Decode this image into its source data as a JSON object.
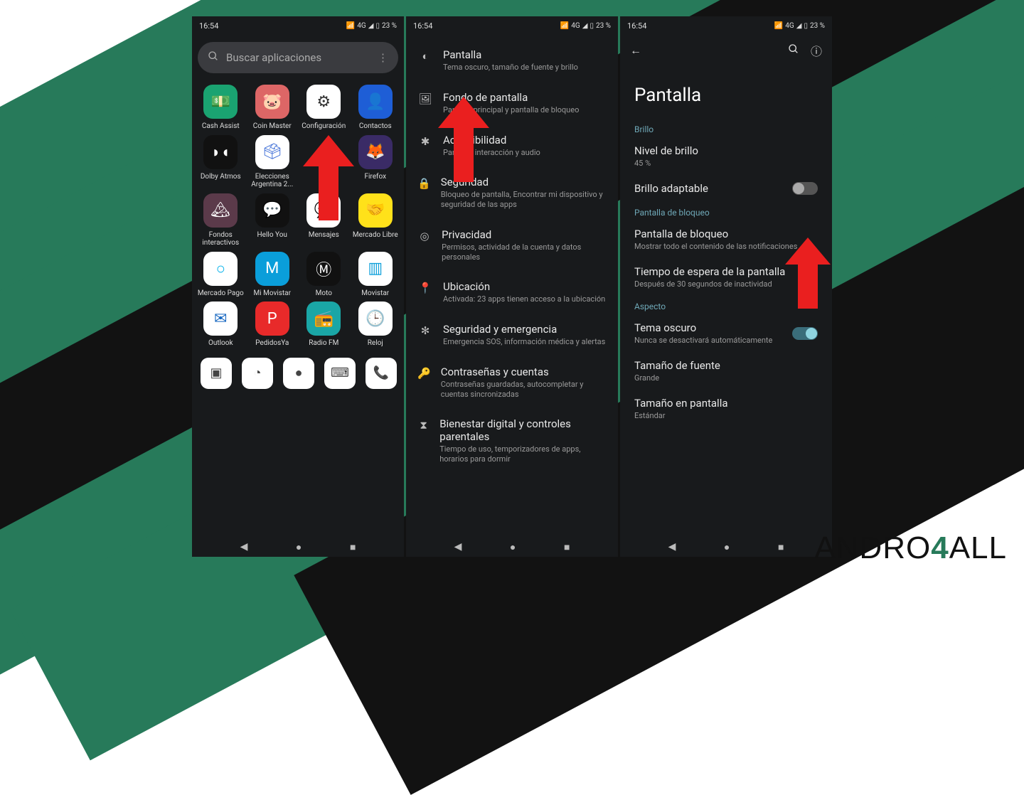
{
  "status": {
    "time": "16:54",
    "battery": "23 %",
    "signal_text": "4G"
  },
  "phone1": {
    "search_placeholder": "Buscar aplicaciones",
    "apps": [
      {
        "label": "Cash Assist",
        "emoji": "💵",
        "bg": "#1aa371",
        "fg": "#fff"
      },
      {
        "label": "Coin Master",
        "emoji": "🐷",
        "bg": "#d66",
        "fg": "#fff"
      },
      {
        "label": "Configuración",
        "emoji": "⚙",
        "bg": "#fff",
        "fg": "#333"
      },
      {
        "label": "Contactos",
        "emoji": "👤",
        "bg": "#1e5ed6",
        "fg": "#fff"
      },
      {
        "label": "Dolby Atmos",
        "emoji": "◗◖",
        "bg": "#111",
        "fg": "#fff"
      },
      {
        "label": "Elecciones Argentina 2...",
        "emoji": "🗳",
        "bg": "#fff",
        "fg": "#3a6bd6"
      },
      {
        "label": "",
        "emoji": "",
        "bg": "transparent",
        "fg": "transparent"
      },
      {
        "label": "Firefox",
        "emoji": "🦊",
        "bg": "#3a2b66",
        "fg": "#fff"
      },
      {
        "label": "Fondos interactivos",
        "emoji": "🏔",
        "bg": "#5b3a4a",
        "fg": "#fff"
      },
      {
        "label": "Hello You",
        "emoji": "💬",
        "bg": "#111",
        "fg": "#fff"
      },
      {
        "label": "Mensajes",
        "emoji": "💬",
        "bg": "#fff",
        "fg": "#2d6bff"
      },
      {
        "label": "Mercado Libre",
        "emoji": "🤝",
        "bg": "#ffe11a",
        "fg": "#333"
      },
      {
        "label": "Mercado Pago",
        "emoji": "○",
        "bg": "#fff",
        "fg": "#00b1ea"
      },
      {
        "label": "Mi Movistar",
        "emoji": "M",
        "bg": "#0a9eda",
        "fg": "#fff"
      },
      {
        "label": "Moto",
        "emoji": "Ⓜ",
        "bg": "#111",
        "fg": "#fff"
      },
      {
        "label": "Movistar",
        "emoji": "▥",
        "bg": "#fff",
        "fg": "#0a9eda"
      },
      {
        "label": "Outlook",
        "emoji": "✉",
        "bg": "#fff",
        "fg": "#1566c0"
      },
      {
        "label": "PedidosYa",
        "emoji": "P",
        "bg": "#e82a2a",
        "fg": "#fff"
      },
      {
        "label": "Radio FM",
        "emoji": "📻",
        "bg": "#1aa6a6",
        "fg": "#fff"
      },
      {
        "label": "Reloj",
        "emoji": "🕒",
        "bg": "#fff",
        "fg": "#333"
      }
    ],
    "partial_icons": [
      "▣",
      "◔",
      "●",
      "⌨",
      "📞"
    ]
  },
  "phone2": {
    "items": [
      {
        "icon": "◐",
        "title": "Pantalla",
        "sub": "Tema oscuro, tamaño de fuente y brillo"
      },
      {
        "icon": "🖼",
        "title": "Fondo de pantalla",
        "sub": "Pantalla principal y pantalla de bloqueo"
      },
      {
        "icon": "✱",
        "title": "Accesibilidad",
        "sub": "Pantalla, interacción y audio"
      },
      {
        "icon": "🔒",
        "title": "Seguridad",
        "sub": "Bloqueo de pantalla, Encontrar mi dispositivo y seguridad de las apps"
      },
      {
        "icon": "◎",
        "title": "Privacidad",
        "sub": "Permisos, actividad de la cuenta y datos personales"
      },
      {
        "icon": "📍",
        "title": "Ubicación",
        "sub": "Activada: 23 apps tienen acceso a la ubicación"
      },
      {
        "icon": "✻",
        "title": "Seguridad y emergencia",
        "sub": "Emergencia SOS, información médica y alertas"
      },
      {
        "icon": "🔑",
        "title": "Contraseñas y cuentas",
        "sub": "Contraseñas guardadas, autocompletar y cuentas sincronizadas"
      },
      {
        "icon": "⧗",
        "title": "Bienestar digital y controles parentales",
        "sub": "Tiempo de uso, temporizadores de apps, horarios para dormir"
      }
    ]
  },
  "phone3": {
    "title": "Pantalla",
    "sections": [
      {
        "label": "Brillo",
        "prefs": [
          {
            "title": "Nivel de brillo",
            "sub": "45 %",
            "toggle": null
          },
          {
            "title": "Brillo adaptable",
            "sub": "",
            "toggle": false
          }
        ]
      },
      {
        "label": "Pantalla de bloqueo",
        "prefs": [
          {
            "title": "Pantalla de bloqueo",
            "sub": "Mostrar todo el contenido de las notificaciones",
            "toggle": null
          },
          {
            "title": "Tiempo de espera de la pantalla",
            "sub": "Después de 30 segundos de inactividad",
            "toggle": null
          }
        ]
      },
      {
        "label": "Aspecto",
        "prefs": [
          {
            "title": "Tema oscuro",
            "sub": "Nunca se desactivará automáticamente",
            "toggle": true
          },
          {
            "title": "Tamaño de fuente",
            "sub": "Grande",
            "toggle": null
          },
          {
            "title": "Tamaño en pantalla",
            "sub": "Estándar",
            "toggle": null
          }
        ]
      }
    ]
  },
  "logo": {
    "pre": "ANDRO",
    "four": "4",
    "post": "ALL"
  }
}
